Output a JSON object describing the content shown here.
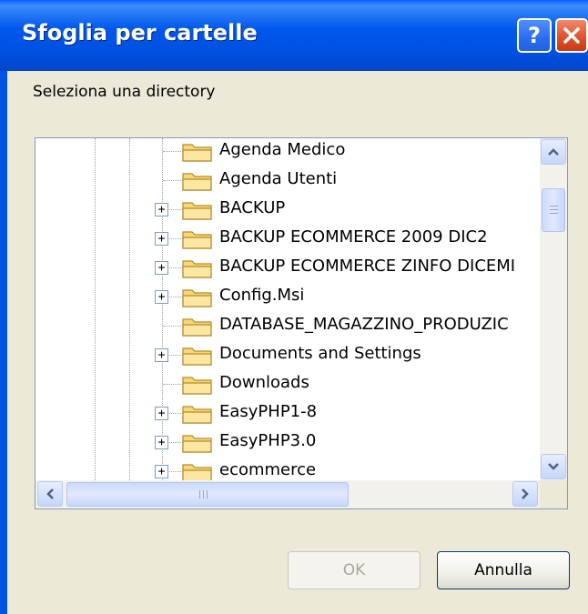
{
  "dialog": {
    "title": "Sfoglia per cartelle",
    "help_label": "?",
    "prompt": "Seleziona una directory"
  },
  "tree": {
    "items": [
      {
        "label": "Agenda Medico",
        "expandable": false
      },
      {
        "label": "Agenda Utenti",
        "expandable": false
      },
      {
        "label": "BACKUP",
        "expandable": true
      },
      {
        "label": "BACKUP ECOMMERCE 2009 DIC2",
        "expandable": true
      },
      {
        "label": "BACKUP ECOMMERCE ZINFO DICEMI",
        "expandable": true
      },
      {
        "label": "Config.Msi",
        "expandable": true
      },
      {
        "label": "DATABASE_MAGAZZINO_PRODUZIC",
        "expandable": false
      },
      {
        "label": "Documents and Settings",
        "expandable": true
      },
      {
        "label": "Downloads",
        "expandable": false
      },
      {
        "label": "EasyPHP1-8",
        "expandable": true
      },
      {
        "label": "EasyPHP3.0",
        "expandable": true
      },
      {
        "label": "ecommerce",
        "expandable": true
      }
    ],
    "expander_symbol": "+"
  },
  "buttons": {
    "ok_label": "OK",
    "cancel_label": "Annulla",
    "ok_enabled": false
  },
  "icons": {
    "folder": "folder-icon",
    "close": "close-icon",
    "help": "help-icon",
    "scroll_up": "chevron-up-icon",
    "scroll_down": "chevron-down-icon",
    "scroll_left": "chevron-left-icon",
    "scroll_right": "chevron-right-icon"
  },
  "colors": {
    "titlebar": "#0054e3",
    "dialog_bg": "#ece9d8",
    "folder_fill": "#f8d775",
    "folder_stroke": "#b48a2c"
  }
}
